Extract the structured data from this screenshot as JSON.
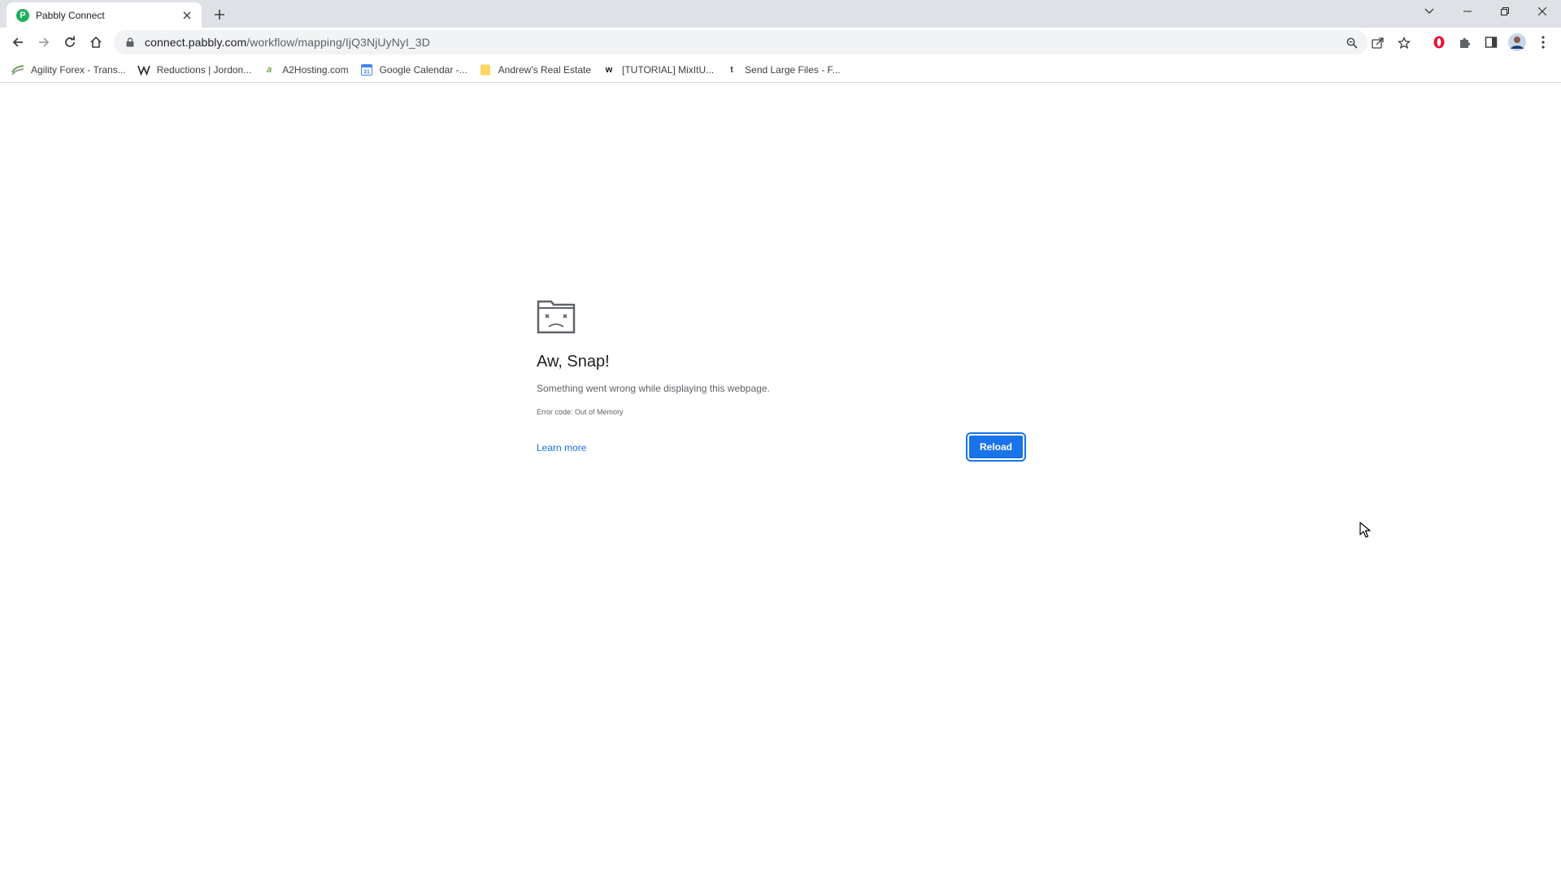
{
  "tab": {
    "favicon_letter": "P",
    "title": "Pabbly Connect"
  },
  "omnibox": {
    "domain": "connect.pabbly.com",
    "path": "/workflow/mapping/IjQ3NjUyNyI_3D"
  },
  "bookmarks": [
    {
      "icon": "agility-forex-icon",
      "label": "Agility Forex - Trans..."
    },
    {
      "icon": "w-logo-icon",
      "label": "Reductions | Jordon..."
    },
    {
      "icon": "a2hosting-icon",
      "label": "A2Hosting.com"
    },
    {
      "icon": "google-calendar-icon",
      "label": "Google Calendar -..."
    },
    {
      "icon": "folder-icon",
      "label": "Andrew's Real Estate"
    },
    {
      "icon": "w-bold-icon",
      "label": "[TUTORIAL] MixItU..."
    },
    {
      "icon": "tumblr-icon",
      "label": "Send Large Files - F..."
    }
  ],
  "error_page": {
    "title": "Aw, Snap!",
    "message": "Something went wrong while displaying this webpage.",
    "code": "Error code: Out of Memory",
    "learn_more": "Learn more",
    "reload": "Reload"
  },
  "colors": {
    "accent": "#1a73e8",
    "tabstrip": "#dee1e6",
    "pabbly_green": "#1fb05e",
    "opera_red": "#e8132f"
  }
}
